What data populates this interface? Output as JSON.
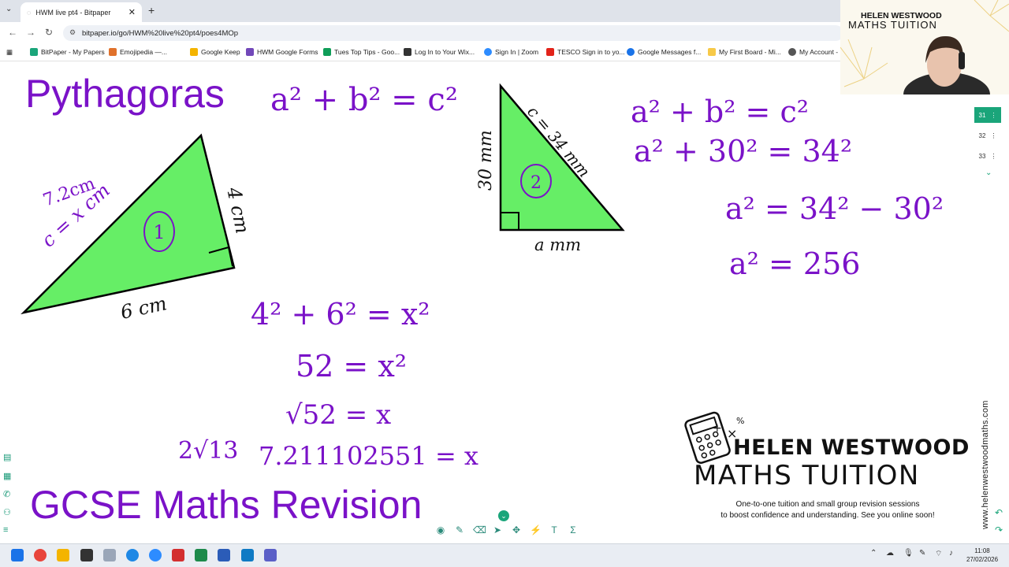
{
  "browser": {
    "tab_title": "HWM live pt4 - Bitpaper",
    "url": "bitpaper.io/go/HWM%20live%20pt4/poes4MOp",
    "bookmarks": [
      {
        "label": "BitPaper - My Papers",
        "color": "#1aa57a"
      },
      {
        "label": "Emojipedia —...",
        "color": "#e0712b"
      },
      {
        "label": "Google Keep",
        "color": "#f4b400"
      },
      {
        "label": "HWM Google Forms",
        "color": "#7248b9"
      },
      {
        "label": "Tues Top Tips - Goo...",
        "color": "#0f9d58"
      },
      {
        "label": "Log In to Your Wix...",
        "color": "#333333"
      },
      {
        "label": "Sign In | Zoom",
        "color": "#2d8cff"
      },
      {
        "label": "TESCO Sign in to yo...",
        "color": "#e2231a"
      },
      {
        "label": "Google Messages f...",
        "color": "#1a73e8"
      },
      {
        "label": "My First Board - Mi...",
        "color": "#f7c948"
      },
      {
        "label": "My Account - I",
        "color": "#555555"
      }
    ]
  },
  "webcam": {
    "logo_line1": "HELEN WESTWOOD",
    "logo_line2": "MATHS TUITION"
  },
  "pages": [
    {
      "num": "31",
      "active": true
    },
    {
      "num": "32",
      "active": false
    },
    {
      "num": "33",
      "active": false
    }
  ],
  "board": {
    "title": "Pythagoras",
    "subtitle": "GCSE Maths Revision",
    "formula_top": "a² + b² = c²",
    "triangle1": {
      "side_a": "4 cm",
      "side_b": "6 cm",
      "hyp": "c = x cm",
      "answer_note": "7.2cm",
      "label": "1"
    },
    "triangle2": {
      "side_a": "30 mm",
      "side_b": "a mm",
      "hyp": "c = 34 mm",
      "label": "2"
    },
    "work1": [
      "4² + 6² = x²",
      "52 = x²",
      "√52 = x",
      "7.211102551 = x"
    ],
    "work1_note": "2√13",
    "work2": [
      "a² + b² = c²",
      "a² + 30² = 34²",
      "a² = 34² − 30²",
      "a² = 256"
    ]
  },
  "brand": {
    "name": "HELEN WESTWOOD",
    "sub": "MATHS TUITION",
    "tagline_1": "One-to-one tuition and small group revision sessions",
    "tagline_2": "to boost confidence and understanding. See you online soon!",
    "website": "www.helenwestwoodmaths.com"
  },
  "taskbar": {
    "time": "11:08",
    "date": "27/02/2026"
  },
  "colors": {
    "pen": "#7a12c8",
    "triangle_fill": "#66ee66",
    "accent": "#1aa57a"
  }
}
